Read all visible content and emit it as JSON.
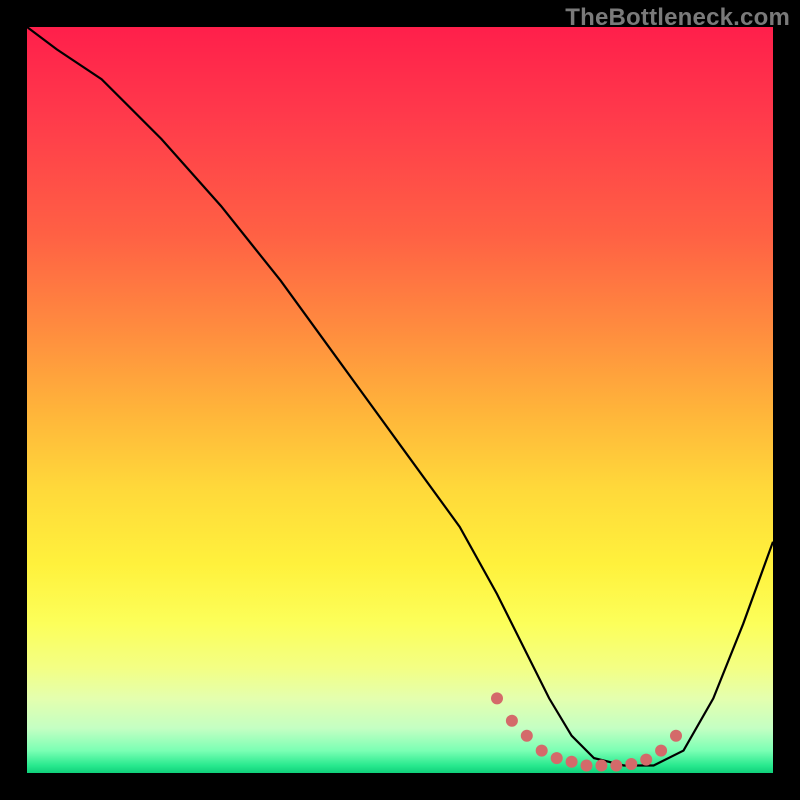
{
  "watermark": "TheBottleneck.com",
  "chart_data": {
    "type": "line",
    "title": "",
    "xlabel": "",
    "ylabel": "",
    "xlim": [
      0,
      100
    ],
    "ylim": [
      0,
      100
    ],
    "grid": false,
    "series": [
      {
        "name": "bottleneck-curve",
        "x": [
          0,
          4,
          10,
          18,
          26,
          34,
          42,
          50,
          58,
          63,
          67,
          70,
          73,
          76,
          80,
          84,
          88,
          92,
          96,
          100
        ],
        "y": [
          100,
          97,
          93,
          85,
          76,
          66,
          55,
          44,
          33,
          24,
          16,
          10,
          5,
          2,
          1,
          1,
          3,
          10,
          20,
          31
        ]
      }
    ],
    "highlight": {
      "name": "optimal-region-dots",
      "color": "#d46a6a",
      "x": [
        63,
        65,
        67,
        69,
        71,
        73,
        75,
        77,
        79,
        81,
        83,
        85,
        87
      ],
      "y": [
        10,
        7,
        5,
        3,
        2,
        1.5,
        1,
        1,
        1,
        1.2,
        1.8,
        3,
        5
      ]
    },
    "gradient_stops": [
      {
        "pos": 0,
        "color": "#ff1f4b"
      },
      {
        "pos": 12,
        "color": "#ff3a4b"
      },
      {
        "pos": 28,
        "color": "#ff6144"
      },
      {
        "pos": 40,
        "color": "#ff8a3f"
      },
      {
        "pos": 52,
        "color": "#ffb63a"
      },
      {
        "pos": 62,
        "color": "#ffd93a"
      },
      {
        "pos": 72,
        "color": "#fff13c"
      },
      {
        "pos": 80,
        "color": "#fcff5a"
      },
      {
        "pos": 86,
        "color": "#f3ff85"
      },
      {
        "pos": 90,
        "color": "#e4ffae"
      },
      {
        "pos": 94,
        "color": "#c4ffc3"
      },
      {
        "pos": 97,
        "color": "#7bffb4"
      },
      {
        "pos": 99,
        "color": "#28e98e"
      },
      {
        "pos": 100,
        "color": "#0fd07a"
      }
    ]
  }
}
